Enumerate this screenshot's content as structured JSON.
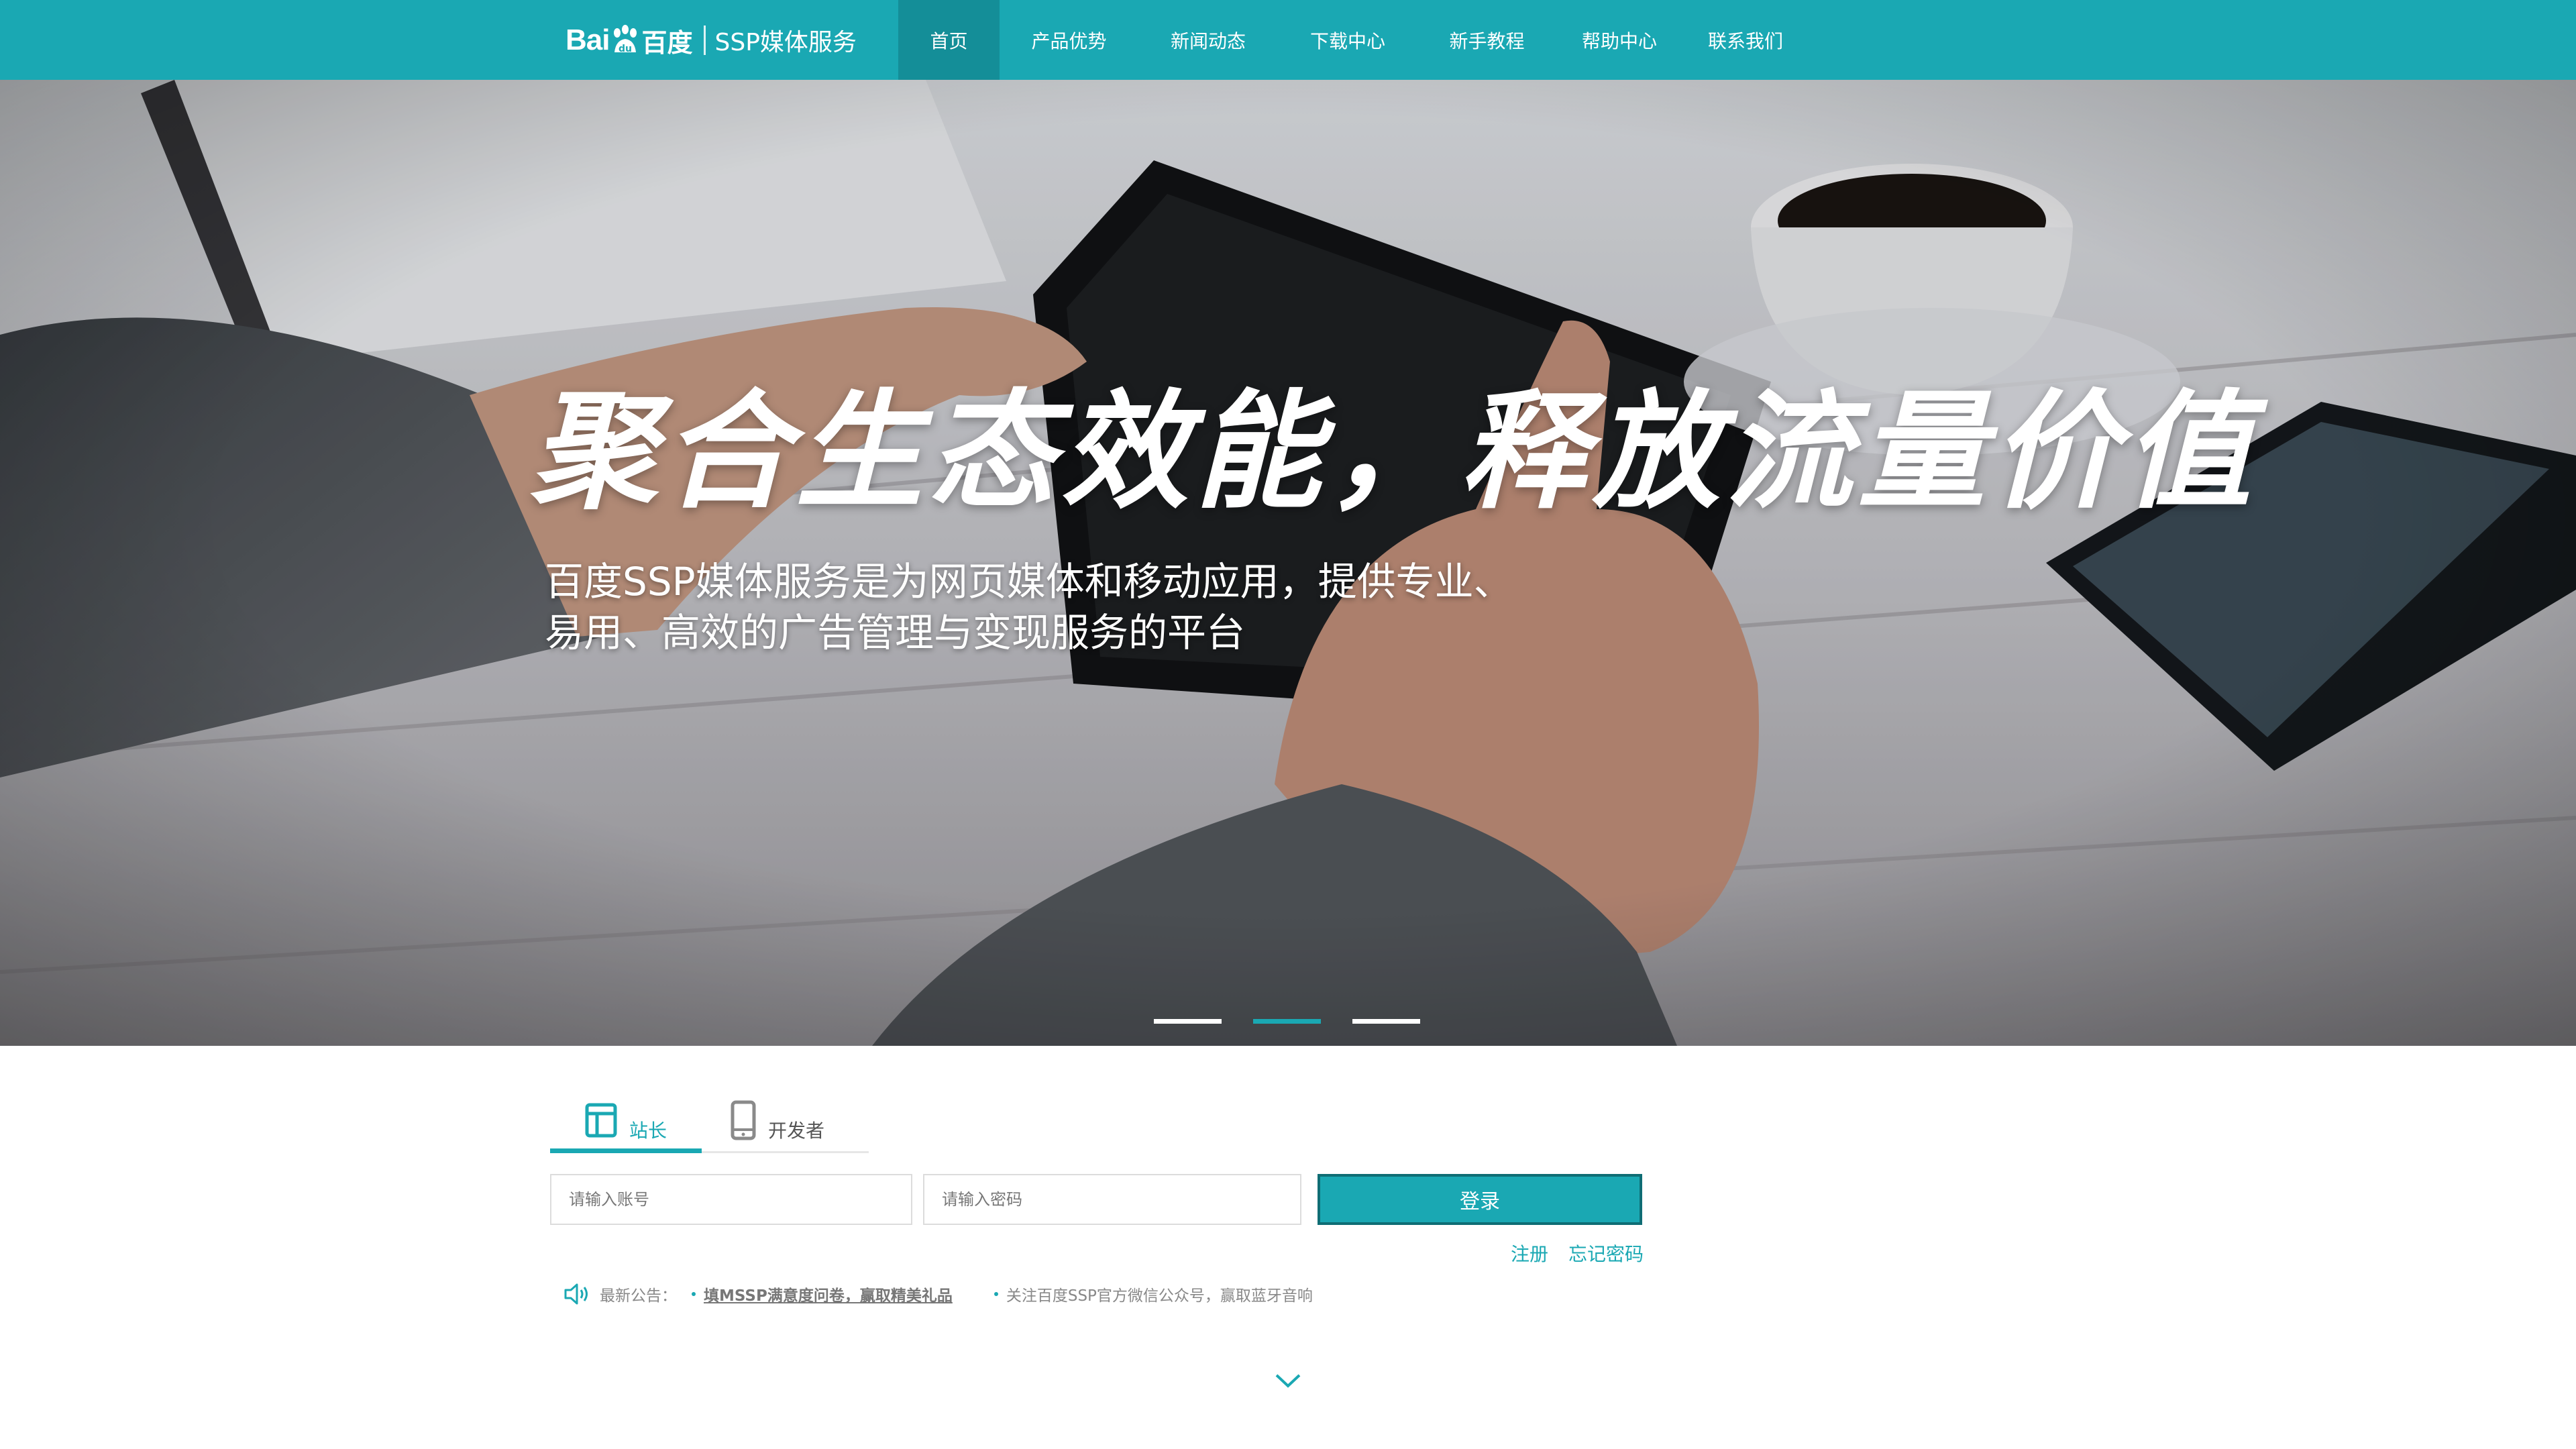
{
  "header": {
    "logo_bai": "Bai",
    "logo_baidu_cn": "百度",
    "logo_product": "SSP媒体服务",
    "colors": {
      "brand": "#1aa8b3",
      "active_nav": "#148e98"
    },
    "nav": [
      {
        "label": "首页",
        "active": true
      },
      {
        "label": "产品优势"
      },
      {
        "label": "新闻动态"
      },
      {
        "label": "下载中心"
      },
      {
        "label": "新手教程"
      },
      {
        "label": "帮助中心"
      },
      {
        "label": "联系我们"
      }
    ]
  },
  "hero": {
    "slogan": "聚合生态效能，释放流量价值",
    "description_line1": "百度SSP媒体服务是为网页媒体和移动应用，提供专业、",
    "description_line2": "易用、高效的广告管理与变现服务的平台",
    "carousel_active_index": 1
  },
  "login": {
    "tabs": [
      {
        "label": "站长",
        "icon": "webmaster-icon",
        "active": true
      },
      {
        "label": "开发者",
        "icon": "mobile-phone-icon"
      }
    ],
    "account_placeholder": "请输入账号",
    "password_placeholder": "请输入密码",
    "submit_label": "登录",
    "register_label": "注册",
    "forgot_label": "忘记密码"
  },
  "notice": {
    "prefix": "最新公告：",
    "item1": "填MSSP满意度问卷，赢取精美礼品",
    "item2": "关注百度SSP官方微信公众号，赢取蓝牙音响"
  }
}
